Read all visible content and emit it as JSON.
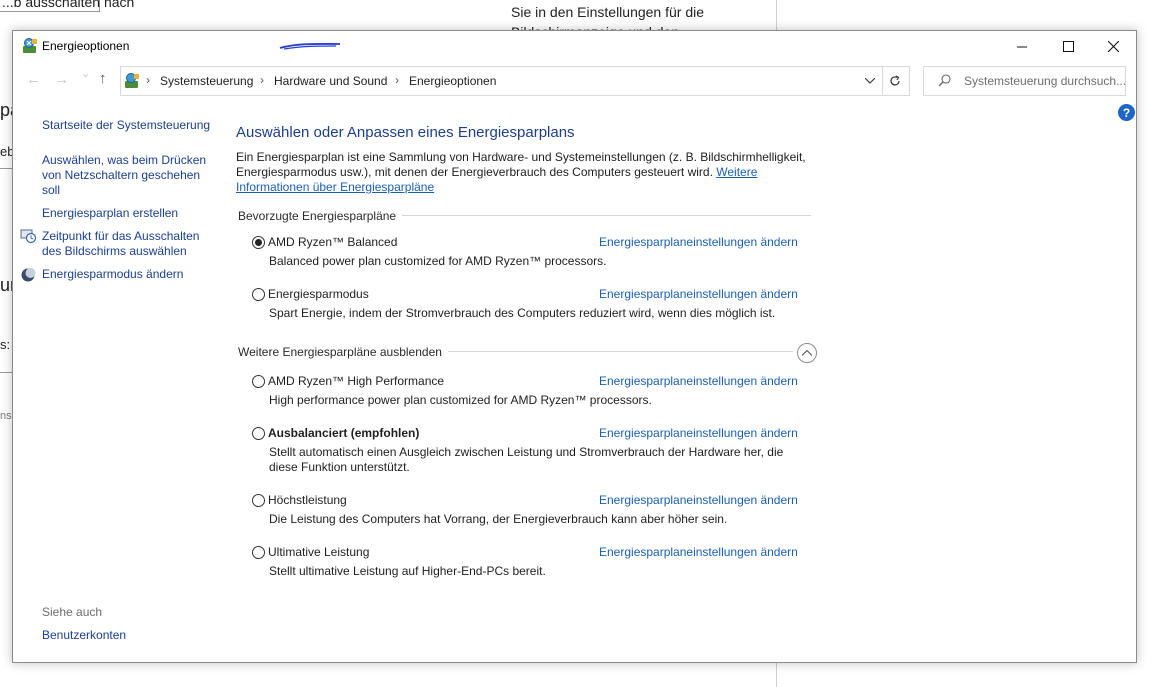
{
  "background": {
    "fragment1": "...b ausschalten nach",
    "fragment2": "Sie in den Einstellungen für die",
    "fragment3": "Bildschirmanzeige und den",
    "frag_a": "pa",
    "frag_b": "eb",
    "frag_c": "ur",
    "frag_d": "s: E",
    "frag_e": "ns"
  },
  "window": {
    "title": "Energieoptionen",
    "minimize_icon": "minimize-icon",
    "maximize_icon": "maximize-icon",
    "close_icon": "close-icon"
  },
  "nav": {
    "back": "←",
    "forward": "→",
    "recent": "⌄",
    "up": "↑",
    "breadcrumb": [
      "Systemsteuerung",
      "Hardware und Sound",
      "Energieoptionen"
    ],
    "separator": "›",
    "search_placeholder": "Systemsteuerung durchsuch..."
  },
  "sidebar": {
    "home": "Startseite der Systemsteuerung",
    "items": [
      {
        "label": "Auswählen, was beim Drücken von Netzschaltern geschehen soll"
      },
      {
        "label": "Energiesparplan erstellen"
      },
      {
        "label": "Zeitpunkt für das Ausschalten des Bildschirms auswählen",
        "icon": "display-clock-icon"
      },
      {
        "label": "Energiesparmodus ändern",
        "icon": "moon-icon"
      }
    ],
    "see_also_label": "Siehe auch",
    "see_also_link": "Benutzerkonten"
  },
  "main": {
    "heading": "Auswählen oder Anpassen eines Energiesparplans",
    "intro": "Ein Energiesparplan ist eine Sammlung von Hardware- und Systemeinstellungen (z. B. Bildschirmhelligkeit, Energiesparmodus usw.), mit denen der Energieverbrauch des Computers gesteuert wird.",
    "intro_link": "Weitere Informationen über Energiesparpläne",
    "preferred_title": "Bevorzugte Energiesparpläne",
    "more_title": "Weitere Energiesparpläne ausblenden",
    "change_link": "Energiesparplaneinstellungen ändern",
    "preferred_plans": [
      {
        "name": "AMD Ryzen™ Balanced",
        "desc": "Balanced power plan customized for AMD Ryzen™ processors.",
        "selected": true
      },
      {
        "name": "Energiesparmodus",
        "desc": "Spart Energie, indem der Stromverbrauch des Computers reduziert wird, wenn dies möglich ist.",
        "selected": false
      }
    ],
    "more_plans": [
      {
        "name": "AMD Ryzen™ High Performance",
        "desc": "High performance power plan customized for AMD Ryzen™ processors."
      },
      {
        "name": "Ausbalanciert (empfohlen)",
        "desc": "Stellt automatisch einen Ausgleich zwischen Leistung und Stromverbrauch der Hardware her, die diese Funktion unterstützt."
      },
      {
        "name": "Höchstleistung",
        "desc": "Die Leistung des Computers hat Vorrang, der Energieverbrauch kann aber höher sein."
      },
      {
        "name": "Ultimative Leistung",
        "desc": "Stellt ultimative Leistung auf Higher-End-PCs bereit."
      }
    ]
  }
}
